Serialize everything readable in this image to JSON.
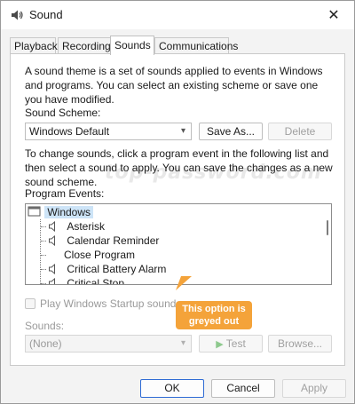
{
  "window": {
    "title": "Sound",
    "close_glyph": "✕"
  },
  "tabs": [
    {
      "label": "Playback",
      "active": false
    },
    {
      "label": "Recording",
      "active": false
    },
    {
      "label": "Sounds",
      "active": true
    },
    {
      "label": "Communications",
      "active": false
    }
  ],
  "sounds_tab": {
    "theme_description": "A sound theme is a set of sounds applied to events in Windows and programs.  You can select an existing scheme or save one you have modified.",
    "scheme_label": "Sound Scheme:",
    "scheme_value": "Windows Default",
    "save_as_label": "Save As...",
    "delete_label": "Delete",
    "change_description": "To change sounds, click a program event in the following list and then select a sound to apply.  You can save the changes as a new sound scheme.",
    "events_label": "Program Events:",
    "events": {
      "root": "Windows",
      "items": [
        "Asterisk",
        "Calendar Reminder",
        "Close Program",
        "Critical Battery Alarm",
        "Critical Stop"
      ]
    },
    "startup_sound_label": "Play Windows Startup sound",
    "startup_sound_checked": false,
    "sounds_label": "Sounds:",
    "sound_value": "(None)",
    "test_label": "Test",
    "browse_label": "Browse..."
  },
  "annotation": {
    "watermark": "top-password.com",
    "callout_text": "This option is greyed out",
    "callout_color": "#f4a33a"
  },
  "footer": {
    "ok_label": "OK",
    "cancel_label": "Cancel",
    "apply_label": "Apply"
  },
  "colors": {
    "selection": "#cde4f7",
    "primary_border": "#2e6bd4"
  }
}
